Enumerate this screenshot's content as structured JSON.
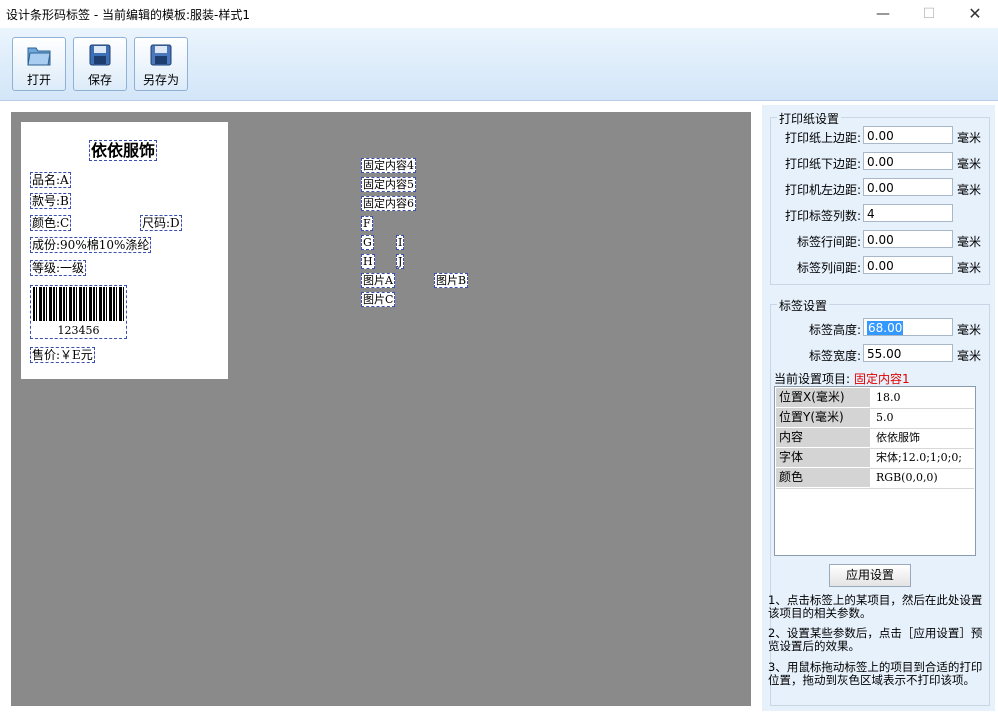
{
  "window": {
    "title": "设计条形码标签 - 当前编辑的模板:服装-样式1",
    "min": "—",
    "max": "☐",
    "close": "✕"
  },
  "toolbar": {
    "open": "打开",
    "save": "保存",
    "save_as": "另存为"
  },
  "label": {
    "title": "依依服饰",
    "name": "品名:A",
    "code": "款号:B",
    "color": "颜色:C",
    "size": "尺码:D",
    "material": "成份:90%棉10%涤纶",
    "grade": "等级:一级",
    "barcode": "123456",
    "price": "售价:￥E元"
  },
  "canvas_items": {
    "fixed4": "固定内容4",
    "fixed5": "固定内容5",
    "fixed6": "固定内容6",
    "f": "F",
    "g": "G",
    "h": "H",
    "i": "I",
    "j": "J",
    "picA": "图片A",
    "picB": "图片B",
    "picC": "图片C"
  },
  "paper_settings": {
    "title": "打印纸设置",
    "rows": [
      {
        "label": "打印纸上边距:",
        "value": "0.00",
        "unit": "毫米"
      },
      {
        "label": "打印纸下边距:",
        "value": "0.00",
        "unit": "毫米"
      },
      {
        "label": "打印机左边距:",
        "value": "0.00",
        "unit": "毫米"
      },
      {
        "label": "打印标签列数:",
        "value": "4",
        "unit": ""
      },
      {
        "label": "标签行间距:",
        "value": "0.00",
        "unit": "毫米"
      },
      {
        "label": "标签列间距:",
        "value": "0.00",
        "unit": "毫米"
      }
    ]
  },
  "label_settings": {
    "title": "标签设置",
    "height_label": "标签高度:",
    "height_value": "68.00",
    "width_label": "标签宽度:",
    "width_value": "55.00",
    "unit": "毫米",
    "current_label": "当前设置项目:",
    "current_value": "固定内容1",
    "props": [
      {
        "key": "位置X(毫米)",
        "value": "18.0"
      },
      {
        "key": "位置Y(毫米)",
        "value": "5.0"
      },
      {
        "key": "内容",
        "value": "依依服饰"
      },
      {
        "key": "字体",
        "value": "宋体;12.0;1;0;0;"
      },
      {
        "key": "颜色",
        "value": "RGB(0,0,0)"
      }
    ],
    "apply": "应用设置"
  },
  "tips": [
    "1、点击标签上的某项目，然后在此处设置该项目的相关参数。",
    "2、设置某些参数后，点击［应用设置］预览设置后的效果。",
    "3、用鼠标拖动标签上的项目到合适的打印位置，拖动到灰色区域表示不打印该项。"
  ]
}
